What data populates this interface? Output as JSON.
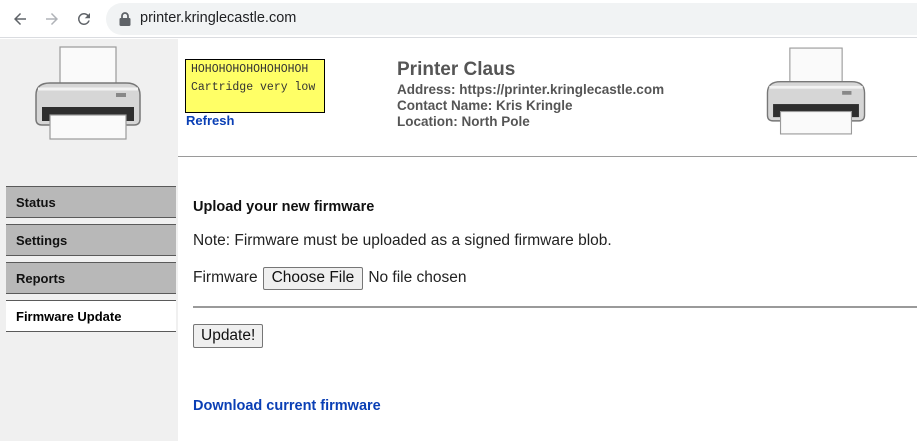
{
  "browser": {
    "url": "printer.kringlecastle.com",
    "icons": [
      "back-arrow-icon",
      "forward-arrow-icon",
      "reload-icon",
      "lock-icon"
    ]
  },
  "header": {
    "alert_hoho": "HOHOHOHOHOHOHOHOH",
    "alert_message": "Cartridge very low",
    "refresh_label": "Refresh",
    "printer_name": "Printer Claus",
    "address": "Address: https://printer.kringlecastle.com",
    "contact": "Contact Name: Kris Kringle",
    "location": "Location: North Pole"
  },
  "sidebar": {
    "items": [
      {
        "label": "Status",
        "active": false
      },
      {
        "label": "Settings",
        "active": false
      },
      {
        "label": "Reports",
        "active": false
      },
      {
        "label": "Firmware Update",
        "active": true
      }
    ]
  },
  "main": {
    "title": "Upload your new firmware",
    "note": "Note: Firmware must be uploaded as a signed firmware blob.",
    "firmware_label": "Firmware",
    "choose_file_label": "Choose File",
    "no_file_text": "No file chosen",
    "update_label": "Update!",
    "download_label": "Download current firmware"
  },
  "colors": {
    "alert_bg": "#ffff66",
    "link": "#0a3fb5",
    "menu_bg": "#b8b8b8",
    "sidebar_bg": "#f0f0f0"
  }
}
